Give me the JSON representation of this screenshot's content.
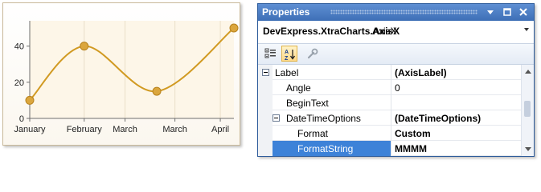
{
  "chart_data": {
    "type": "line",
    "categories": [
      "January",
      "February",
      "March",
      "March",
      "April"
    ],
    "x": [
      0,
      1,
      2,
      3,
      4,
      5
    ],
    "values": [
      10,
      40,
      15,
      50
    ],
    "point_x": [
      0,
      1.2,
      2.8,
      4.5
    ],
    "y_ticks": [
      "0",
      "20",
      "40"
    ],
    "ylim": [
      0,
      54
    ],
    "xlim": [
      0,
      4.5
    ],
    "line_color": "#d19a22",
    "marker_color": "#dba63d",
    "grid": true
  },
  "properties": {
    "title": "Properties",
    "object_name": "DevExpress.XtraCharts.AxisX",
    "object_type": "AxisX",
    "rows": [
      {
        "name": "Label",
        "value": "(AxisLabel)",
        "indent": 0,
        "expandable": true,
        "bold_value": true,
        "selected": false
      },
      {
        "name": "Angle",
        "value": "0",
        "indent": 1,
        "expandable": false,
        "bold_value": false,
        "selected": false
      },
      {
        "name": "BeginText",
        "value": "",
        "indent": 1,
        "expandable": false,
        "bold_value": false,
        "selected": false
      },
      {
        "name": "DateTimeOptions",
        "value": "(DateTimeOptions)",
        "indent": 1,
        "expandable": true,
        "bold_value": true,
        "selected": false
      },
      {
        "name": "Format",
        "value": "Custom",
        "indent": 2,
        "expandable": false,
        "bold_value": true,
        "selected": false
      },
      {
        "name": "FormatString",
        "value": "MMMM",
        "indent": 2,
        "expandable": false,
        "bold_value": true,
        "selected": true
      }
    ],
    "toolbar": [
      {
        "icon": "categorized-icon",
        "active": false
      },
      {
        "icon": "alphabetical-icon",
        "active": true
      },
      {
        "icon": "property-pages-icon",
        "active": false
      }
    ],
    "accent_color": "#3d82d8"
  }
}
